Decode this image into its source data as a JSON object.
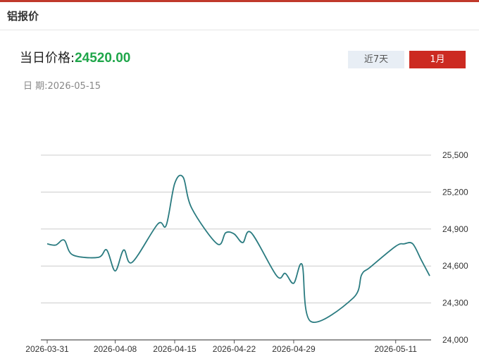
{
  "header": {
    "title": "铝报价"
  },
  "price": {
    "label": "当日价格:",
    "value": "24520.00",
    "value_color": "#1fa64a"
  },
  "date": {
    "label": "日 期:",
    "value": "2026-05-15"
  },
  "range_buttons": {
    "seven_day": "近7天",
    "one_month": "1月",
    "active": "one_month"
  },
  "colors": {
    "accent": "#cc2a21",
    "line": "#2a7b80",
    "grid": "#cccccc"
  },
  "chart_data": {
    "type": "line",
    "title": "",
    "xlabel": "",
    "ylabel": "",
    "ylim": [
      24000,
      25500
    ],
    "yticks": [
      24000,
      24300,
      24600,
      24900,
      25200,
      25500
    ],
    "ytick_labels": [
      "24,000",
      "24,300",
      "24,600",
      "24,900",
      "25,200",
      "25,500"
    ],
    "xtick_labels": [
      "2026-03-31",
      "2026-04-08",
      "2026-04-15",
      "2026-04-22",
      "2026-04-29",
      "2026-05-11"
    ],
    "grid": true,
    "y_axis_side": "right",
    "series": [
      {
        "x": [
          "2026-03-31",
          "2026-04-01",
          "2026-04-02",
          "2026-04-03",
          "2026-04-06",
          "2026-04-07",
          "2026-04-08",
          "2026-04-09",
          "2026-04-10",
          "2026-04-13",
          "2026-04-14",
          "2026-04-15",
          "2026-04-16",
          "2026-04-17",
          "2026-04-20",
          "2026-04-21",
          "2026-04-22",
          "2026-04-23",
          "2026-04-24",
          "2026-04-27",
          "2026-04-28",
          "2026-04-29",
          "2026-04-30",
          "2026-05-01",
          "2026-05-06",
          "2026-05-07",
          "2026-05-08",
          "2026-05-11",
          "2026-05-12",
          "2026-05-13",
          "2026-05-14",
          "2026-05-15"
        ],
        "values": [
          24780,
          24770,
          24810,
          24690,
          24670,
          24730,
          24560,
          24730,
          24630,
          24940,
          24930,
          25270,
          25320,
          25070,
          24780,
          24870,
          24860,
          24790,
          24870,
          24520,
          24540,
          24460,
          24610,
          24150,
          24340,
          24530,
          24590,
          24760,
          24780,
          24780,
          24650,
          24520
        ]
      }
    ]
  }
}
